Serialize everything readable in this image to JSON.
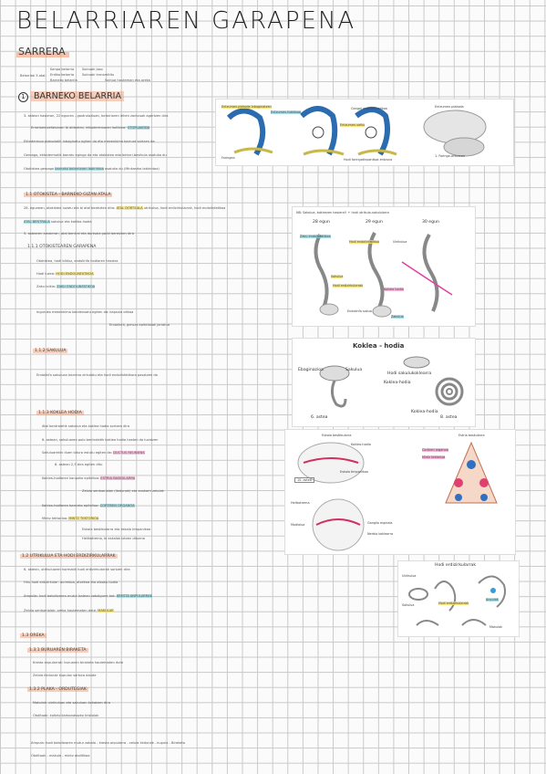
{
  "title": "BELARRIAREN GARAPENA",
  "subtitle": "SARRERA",
  "intro": {
    "lead": "Belarriak 3 atal:",
    "parts": [
      "Kanpo belarria",
      "Erdiko belarria",
      "Barneko belarria"
    ],
    "notes": [
      "Soinuak jaso",
      "Soinuak transmititu",
      "Soinua hauteman eta oreka"
    ]
  },
  "sections": {
    "s1": {
      "num": "1",
      "label": "BARNEKO BELARRIA"
    },
    "s11": {
      "label": "1.1 OTOKISTEA - BARNEKO GIZAN ATALA"
    },
    "s111": {
      "label": "1.1.1 OTOKISTEAREN GARAPENA"
    },
    "s112": {
      "label": "1.1.2 SAKULUA"
    },
    "s113": {
      "label": "1.1.3 KOKLEA HODIA"
    },
    "s12": {
      "label": "1.2 UTRIKULUA ETA HODI ERDIZIRKULARRAK"
    },
    "s13": {
      "label": "1.3 OREKA"
    },
    "s131": {
      "label": "1.3.1 BURUAREN BIRAKETA"
    },
    "s132": {
      "label": "1.3.2 PLAKA - ORDUTEGIAK"
    }
  },
  "body_lines": {
    "a1": "3. astean hasieran, 22 egunen - gastrulazioan, belarriaren lehen zantzuak agertzen dira",
    "a2": "Erronbentzefaloaren bi aldeetan, ektodermoaren loditzea: ",
    "a2_hl": "OTOPLAKODA",
    "a3": "Ektodermoa plakodatik inbaginatu egiten da eta mesenkima barrura sartzen da",
    "a4": "Geroago, ektodermotik banatu egingo da eta otokistea edo belarri-besikula osatuko du",
    "a5": "Otokistea geroago ",
    "a5_hl": "barneko belarriaren labirintoa",
    "a5b": " osatuko du (Mintzezko labirintoa)",
    "b1": "28. egunean, otokistea luzatu eta bi atal bereizten dira:",
    "b1_hl": "ATAL DORTSALA",
    "b1b": "utrikulua, hodi erdizirkularrak, hodi endolinfatikoa",
    "b2_hl": "ATAL BENTRALA",
    "b2b": "sakulua eta koklea-hodia",
    "b3": "5. astearen amaieran, atal bentral eta dortsala garbi bereizten dira",
    "c1": "Otokistea, hodi bilduz, endolinfa hodiaren hasiera",
    "c2": "Hodi luzea: ",
    "c2_hl": "HODI ENDOLINFATIKOA",
    "c3": "Zaku txikia: ",
    "c3_hl": "ZAKU ENDOLINFATIKOA",
    "c4": "Inguruko mesenkima kondensatu egiten da: kapsula otikoa",
    "c5": "Endolinfa, geruza epitelialak jariatua",
    "d1": "Endolinfa sakuluan barrena zirkulatu eta hodi endolinfatikora pasatzen da",
    "e1": "Atal bentraletik sakulua eta koklea hodia sortzen dira",
    "e2": "6. astean, sakuluaren polo bentraletik koklea hodia hasten da luzatzen",
    "e2b": "8. astean 2,5 bira egiten ditu",
    "e3": "Sakuluarekin duen lotura estutu egiten da:",
    "e3_hl": "DUCTUS REUNIENS",
    "f1": "Koklea-hodiaren kanpoko epitelioa: ",
    "f1_hl": "ESTRIA BASKULARRA",
    "f2": "Koklea-hodiaren barneko epitelioa: ",
    "f2_hl": "CORTIREN ORGANOA",
    "f3": "Zelula sentsorialak (iledunak) eta euskarri zelulak",
    "f4": "Mintz tektorioa: ",
    "f4_hl": "MINTZ TEKTORIOA",
    "f5": "Eskala bestibularra eta eskala timpanikoa",
    "f6": "Helikotrema, bi eskalak lotzen dituena",
    "g1": "6. astean, utrikuluaren hormatik hodi erdizirkularrak sortzen dira",
    "g2": "Hiru hodi erdizirkular: aurrekoa, atzekoa eta alboko hodia",
    "g3": "Ampolla: hodi bakoitzaren mutur batean zabalgune bat: ",
    "g3_hl": "KRESTA ANPULARRAK",
    "g4": "Zelula sentsorialak: oreka hautematen dute; ",
    "g4_hl": "MAKULAK",
    "h1": "Kresta anpularrak: buruaren biraketa hautematen dute",
    "h2": "Zelula iledunak kupulan sartuta daude",
    "i1": "Makulak: utrikuluan eta sakuluan kokatzen dira",
    "i2": "Otolitoak: kaltzio karbonatozko kristalak",
    "j1": "Nerbio bestibularra eta nerbio koklearra: VIII. garezurreko nerbioa",
    "j2": "Ganglio espirala eta ganglio bestibularra"
  },
  "figures": {
    "f1": {
      "labels": [
        "Entzumen-plakoda inbaginatzen",
        "Entzumen-hobitxoa",
        "Entzumen-veiku",
        "Gangoi estatoakustikoa",
        "Faringea",
        "Hodi faringotinpanikoa entzuna",
        "Entzumen-plakoda",
        "1. Faringe-arkuaren"
      ]
    },
    "f2": {
      "caption": "NB: Sakulua, koklearen hasiera!! + hodi utrikulo-sakulularra",
      "days": [
        "28 egun",
        "29 egun",
        "30 egun"
      ],
      "labels": [
        "Zaku endolinfatikoa",
        "Hodi endolinfatikoa",
        "Utrikulua",
        "Sakulua",
        "Koklea hodia",
        "Hodi erdizirkularrak",
        "Endolinfa sakua",
        "Zakulua"
      ]
    },
    "f3": {
      "title": "Koklea - hodia",
      "labels": [
        "Ebaginazioa",
        "Sakulua",
        "Hodi sakulukoklearra",
        "Koklea-hodia",
        "Koklea-hodia"
      ],
      "week_a": "6. astea",
      "week_b": "8. astea"
    },
    "f4": {
      "labels": [
        "Eskala bestibularra",
        "Koklea-hodia",
        "Eskala timpanikoa",
        "Helikotrema",
        "Modiolua",
        "Cortiren organoa",
        "Mintz tektorioa",
        "Estria baskularra",
        "Ganglio espirala",
        "Nerbio koklearra"
      ],
      "tag": "10. astea"
    },
    "f5": {
      "title": "Hodi erdizirkularrak",
      "labels": [
        "Utrikulua",
        "Sakulua",
        "Hodi erdizirkularrak",
        "Anpulak",
        "Makulak"
      ]
    }
  },
  "footer": {
    "l1": "Ampula: hodi bakoitzaren mutur zabala - kresta anpularra - zelula iledunak - kupula - Biraketa",
    "l2": "Otolitoak - makula - mintz otolitikoa"
  },
  "colors": {
    "orange": "#f0966e",
    "teal": "#82d2dc",
    "yellow": "#f5e164",
    "pink": "#f596c8",
    "grid": "#c9c9c9"
  }
}
